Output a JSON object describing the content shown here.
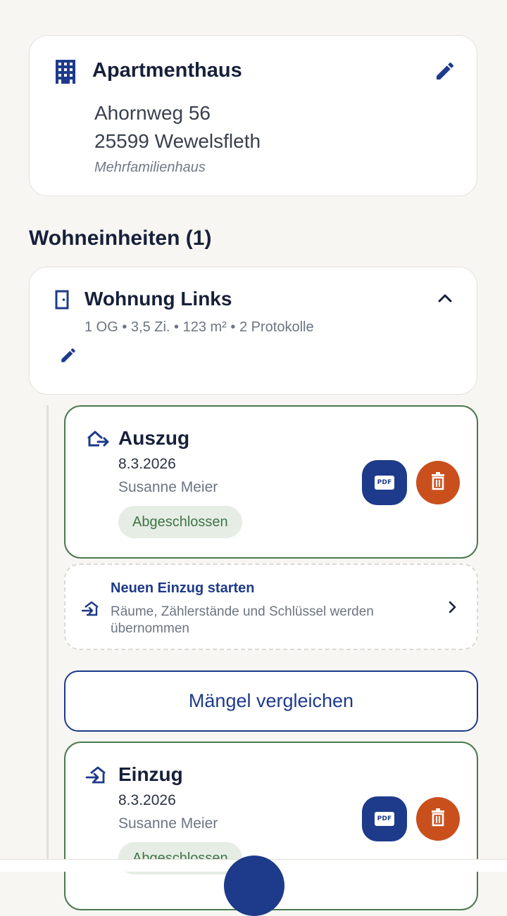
{
  "property": {
    "title": "Apartmenthaus",
    "street": "Ahornweg 56",
    "city": "25599 Wewelsfleth",
    "type": "Mehrfamilienhaus"
  },
  "units_section": {
    "title": "Wohneinheiten (1)"
  },
  "unit": {
    "title": "Wohnung Links",
    "meta": "1 OG • 3,5 Zi. • 123 m² • 2 Protokolle"
  },
  "protocols": [
    {
      "title": "Auszug",
      "date": "8.3.2026",
      "author": "Susanne Meier",
      "status": "Abgeschlossen",
      "pdf_label": "PDF"
    },
    {
      "title": "Einzug",
      "date": "8.3.2026",
      "author": "Susanne Meier",
      "status": "Abgeschlossen",
      "pdf_label": "PDF"
    }
  ],
  "start_move_in": {
    "title": "Neuen Einzug starten",
    "subtitle": "Räume, Zählerstände und Schlüssel werden übernommen"
  },
  "compare_button": {
    "label": "Mängel vergleichen"
  },
  "colors": {
    "primary": "#1e3a8a",
    "danger": "#c9501d",
    "success": "#3f7446",
    "background": "#f7f6f2"
  }
}
